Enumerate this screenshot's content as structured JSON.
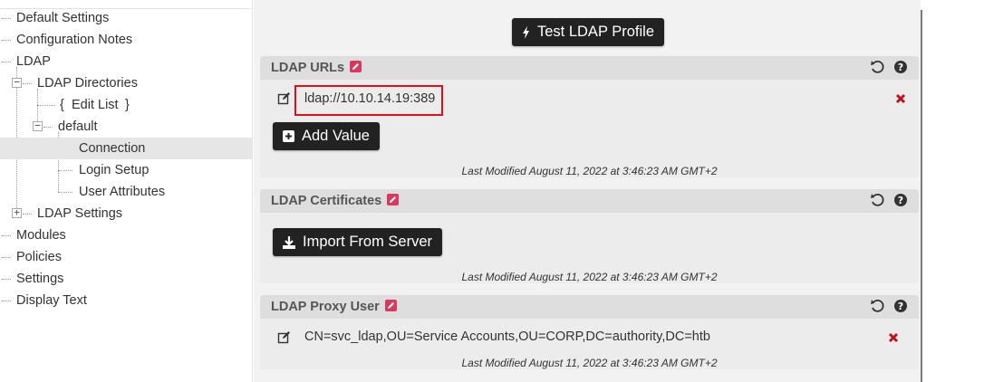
{
  "tree": {
    "items": [
      {
        "label": "Default Settings"
      },
      {
        "label": "Configuration Notes"
      },
      {
        "label": "LDAP"
      },
      {
        "label": "LDAP Directories"
      },
      {
        "label": "Edit List",
        "prefix": "{",
        "suffix": "}"
      },
      {
        "label": "default"
      },
      {
        "label": "Connection"
      },
      {
        "label": "Login Setup"
      },
      {
        "label": "User Attributes"
      },
      {
        "label": "LDAP Settings"
      },
      {
        "label": "Modules"
      },
      {
        "label": "Policies"
      },
      {
        "label": "Settings"
      },
      {
        "label": "Display Text"
      }
    ],
    "selected": "Connection"
  },
  "main": {
    "test_button_label": "Test LDAP Profile",
    "sections": [
      {
        "title": "LDAP URLs",
        "values": [
          "ldap://10.10.14.19:389"
        ],
        "button_label": "Add Value",
        "last_modified": "Last Modified August 11, 2022 at 3:46:23 AM GMT+2"
      },
      {
        "title": "LDAP Certificates",
        "button_label": "Import From Server",
        "last_modified": "Last Modified August 11, 2022 at 3:46:23 AM GMT+2"
      },
      {
        "title": "LDAP Proxy User",
        "values": [
          "CN=svc_ldap,OU=Service Accounts,OU=CORP,DC=authority,DC=htb"
        ],
        "last_modified": "Last Modified August 11, 2022 at 3:46:23 AM GMT+2"
      }
    ]
  },
  "colors": {
    "accent_delete": "#c0101a",
    "highlight": "#e0101a",
    "edit_badge": "#d9385f",
    "button_dark": "#222222"
  },
  "icons": {
    "header": [
      "undo-icon",
      "help-icon"
    ],
    "value_edit": "pencil-icon",
    "value_delete": "delete-icon",
    "add": "plus-square-icon",
    "import": "download-icon",
    "test": "bolt-icon"
  }
}
